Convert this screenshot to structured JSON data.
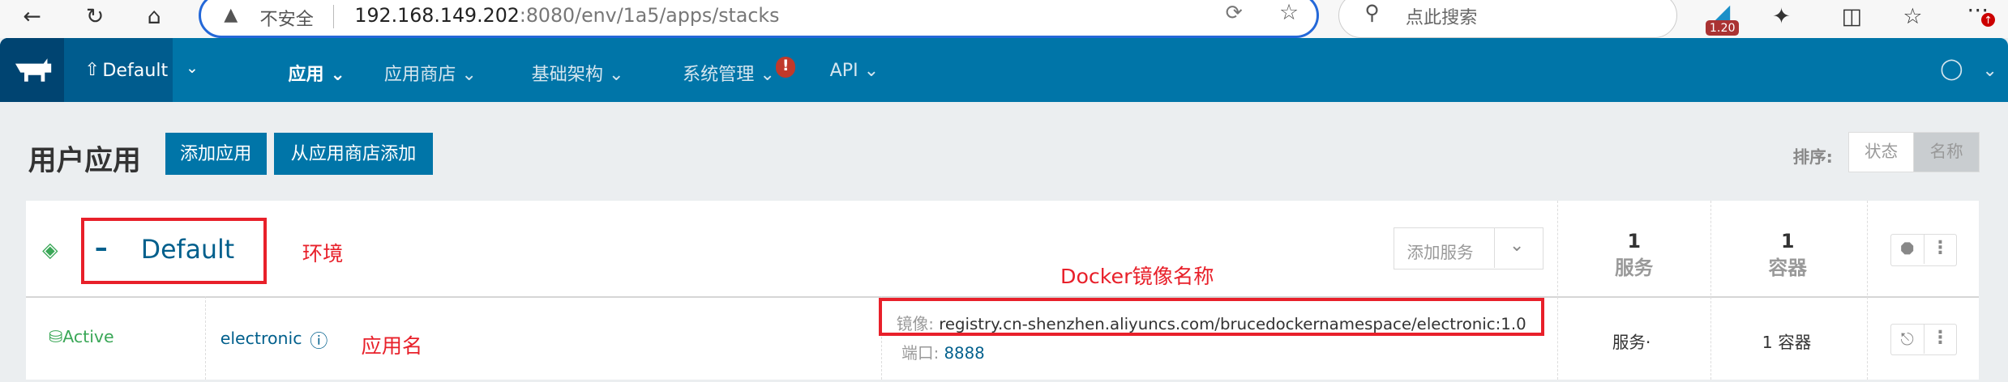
{
  "browser": {
    "security_label": "不安全",
    "url_host": "192.168.149.202",
    "url_rest": ":8080/env/1a5/apps/stacks",
    "search_placeholder": "点此搜索",
    "extension_badge": "1.20"
  },
  "nav": {
    "env": "Default",
    "items": [
      {
        "label": "应用",
        "active": true
      },
      {
        "label": "应用商店"
      },
      {
        "label": "基础架构"
      },
      {
        "label": "系统管理",
        "alert": "!"
      },
      {
        "label": "API"
      }
    ]
  },
  "page": {
    "title": "用户应用",
    "add_app": "添加应用",
    "add_from_catalog": "从应用商店添加",
    "sort_label": "排序:",
    "sort_options": [
      "状态",
      "名称"
    ],
    "sort_selected": "名称"
  },
  "stack": {
    "name": "Default",
    "add_service": "添加服务",
    "services_count": "1",
    "services_label": "服务",
    "containers_count": "1",
    "containers_label": "容器",
    "service": {
      "state": "Active",
      "name": "electronic",
      "image_label": "镜像:",
      "image": "registry.cn-shenzhen.aliyuncs.com/brucedockernamespace/electronic:1.0",
      "port_label": "端口:",
      "port": "8888",
      "scale_label": "服务·",
      "containers": "1 容器"
    }
  },
  "annotations": {
    "env": "环境",
    "image": "Docker镜像名称",
    "app_name": "应用名"
  },
  "colors": {
    "nav": "#0075a8",
    "accent": "#0075a8",
    "active": "#3aa757",
    "annotation": "#e8202a"
  }
}
